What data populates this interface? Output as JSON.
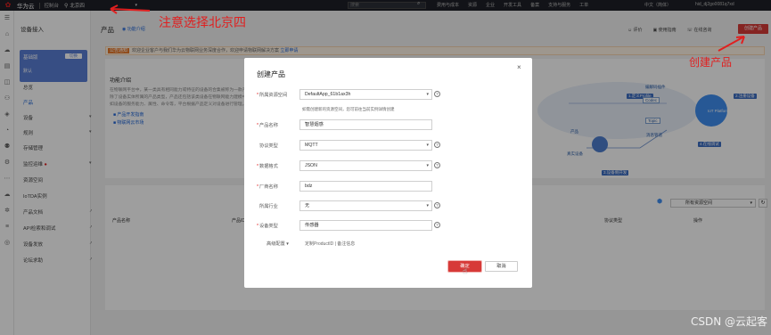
{
  "topbar": {
    "brand": "华为云",
    "console": "控制台",
    "region": "北京四",
    "search_placeholder": "搜索",
    "nav": [
      "费用与成本",
      "资源",
      "企业",
      "开发工具",
      "备案",
      "支持与服务",
      "工单"
    ],
    "language": "中文（简体）",
    "user": "hid_dj2go0081q7xd"
  },
  "rail_icons": [
    "menu-icon",
    "home-icon",
    "cloud-icon",
    "server-icon",
    "database-icon",
    "network-icon",
    "shield-icon",
    "chart-icon",
    "user-icon",
    "settings-icon",
    "ellipsis-icon",
    "cloud-icon",
    "gear-icon",
    "list-icon",
    "globe-icon"
  ],
  "sidebar": {
    "title": "设备接入",
    "tile": {
      "label": "基础版",
      "tag": "切换",
      "sublabel": "默认"
    },
    "items": [
      {
        "label": "总览"
      },
      {
        "label": "产品"
      },
      {
        "label": "设备"
      },
      {
        "label": "规则"
      },
      {
        "label": "存储管理"
      },
      {
        "label": "监控运维"
      },
      {
        "label": "资源空间"
      },
      {
        "label": "IoTDA实例"
      },
      {
        "label": "产品文档"
      },
      {
        "label": "API检索和调试"
      },
      {
        "label": "设备发放"
      },
      {
        "label": "论坛求助"
      }
    ]
  },
  "main": {
    "title": "产品",
    "intro_link": "功能介绍",
    "actions": [
      "评价",
      "使用指南",
      "在线咨询"
    ],
    "create_button": "创建产品",
    "notice": {
      "badge": "公告通知",
      "text": "欢迎企业客户与我们华为云物联网业务深度合作，欢迎申请物联网解决方案",
      "link": "立即申请"
    },
    "func": {
      "title": "功能介绍",
      "lines": [
        "在物联网平台中，某一类具有相同能力或特征的设备的合集被称为一款产品。",
        "除了设备实体所属的产品类型，产品还包括该类设备在物联网能力建模中的信息，",
        "如设备的服务能力、属性、命令等，平台根据产品定义对设备进行管理。了解更多"
      ],
      "links": [
        "产品开发指南",
        "物联网云市场"
      ]
    },
    "diagram": {
      "labels": [
        "1.定义Profile",
        "编解码插件",
        "Codec",
        "Topic",
        "消息管道",
        "产品",
        "真实设备",
        "3.设备侧开发",
        "4.在线调试",
        "2.注册设备",
        "IoT Platform"
      ]
    },
    "list": {
      "filter": "所有资源空间",
      "columns": [
        "产品名称",
        "产品ID",
        "协议类型",
        "操作"
      ]
    }
  },
  "dialog": {
    "title": "创建产品",
    "fields": [
      {
        "label": "所属资源空间",
        "value": "DefaultApp_61b1ax3h",
        "required": true,
        "type": "select"
      },
      {
        "label": "产品名称",
        "value": "智慧烟感",
        "required": true,
        "type": "input"
      },
      {
        "label": "协议类型",
        "value": "MQTT",
        "required": false,
        "type": "select"
      },
      {
        "label": "数据格式",
        "value": "JSON",
        "required": true,
        "type": "select"
      },
      {
        "label": "厂商名称",
        "value": "bdz",
        "required": true,
        "type": "input"
      },
      {
        "label": "所属行业",
        "value": "无",
        "required": false,
        "type": "select"
      },
      {
        "label": "设备类型",
        "value": "传感器",
        "required": true,
        "type": "input"
      }
    ],
    "hint": "如需创建新的资源空间，您可前往当前实例详情创建",
    "hint_link": "前往当前实例详情创建",
    "advanced": "高级配置 ▾",
    "advanced_hint": "定制ProductID | 备注信息",
    "ok": "确定",
    "cancel": "取消"
  },
  "annotations": {
    "region_note": "注意选择北京四",
    "create_note": "创建产品"
  },
  "watermark": "CSDN @云起客",
  "colors": {
    "accent": "#d73a38",
    "link": "#1e64d8",
    "annotation": "#e02020"
  }
}
